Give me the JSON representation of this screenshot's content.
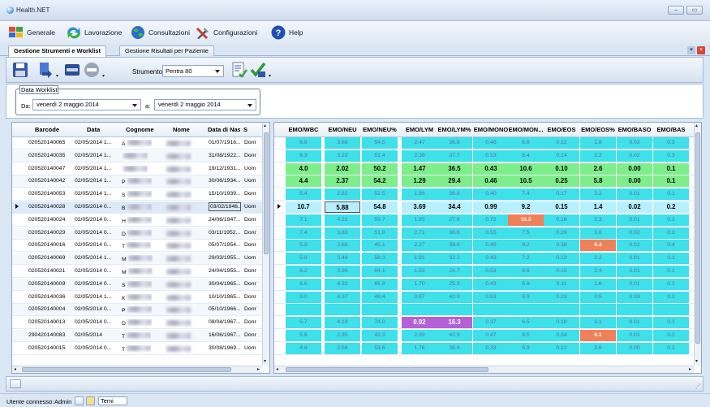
{
  "window": {
    "title": "Health.NET",
    "min_symbol": "–",
    "max_symbol": "▭"
  },
  "menu": [
    {
      "label": "Generale",
      "icon": "generale-icon"
    },
    {
      "label": "Lavorazione",
      "icon": "lavorazione-icon"
    },
    {
      "label": "Consultazioni",
      "icon": "consultazioni-icon"
    },
    {
      "label": "Configurazioni",
      "icon": "configurazioni-icon"
    },
    {
      "label": "Help",
      "icon": "help-icon"
    }
  ],
  "tabs": [
    {
      "label": "Gestione Strumenti e Worklist",
      "active": true
    },
    {
      "label": "Gestione Risultati per Paziente",
      "active": false
    }
  ],
  "toolbar": {
    "strumento_label": "Strumento",
    "strumento_value": "Pentra 80"
  },
  "worklist": {
    "legend": "Data Worklist",
    "da_label": "Da:",
    "da_value": "venerdì 2 maggio 2014",
    "a_label": "a:",
    "a_value": "venerdì 2 maggio 2014"
  },
  "left_grid": {
    "headers": [
      "Barcode",
      "Data",
      "Cognome",
      "Nome",
      "Data di Nas...",
      "S"
    ],
    "rows": [
      {
        "barcode": "020520140065",
        "data": "02/05/2014 1...",
        "cognome": "A",
        "dob": "01/07/1916...",
        "sesso": "Donr"
      },
      {
        "barcode": "020520140035",
        "data": "02/05/2014 1...",
        "cognome": "",
        "dob": "31/08/1922...",
        "sesso": "Donr"
      },
      {
        "barcode": "020520140047",
        "data": "02/05/2014 1...",
        "cognome": "",
        "dob": "19/12/1931...",
        "sesso": "Uom"
      },
      {
        "barcode": "020520140042",
        "data": "02/05/2014 1...",
        "cognome": "P",
        "dob": "30/06/1934...",
        "sesso": "Uom"
      },
      {
        "barcode": "020520140053",
        "data": "02/05/2014 1...",
        "cognome": "S",
        "dob": "15/10/1939...",
        "sesso": "Donr"
      },
      {
        "barcode": "020520140028",
        "data": "02/05/2014 0...",
        "cognome": "B",
        "dob": "03/02/1946...",
        "sesso": "Uom"
      },
      {
        "barcode": "020520140024",
        "data": "02/05/2014 0...",
        "cognome": "H",
        "dob": "24/06/1947...",
        "sesso": "Donr"
      },
      {
        "barcode": "020520140029",
        "data": "02/05/2014 0...",
        "cognome": "D",
        "dob": "03/11/1952...",
        "sesso": "Donr"
      },
      {
        "barcode": "020520140016",
        "data": "02/05/2014 0...",
        "cognome": "T",
        "dob": "05/07/1954...",
        "sesso": "Donr"
      },
      {
        "barcode": "020520140069",
        "data": "02/05/2014 1...",
        "cognome": "M",
        "dob": "29/03/1955...",
        "sesso": "Uom"
      },
      {
        "barcode": "020520140021",
        "data": "02/05/2014 0...",
        "cognome": "M",
        "dob": "24/04/1955...",
        "sesso": "Donr"
      },
      {
        "barcode": "020520140009",
        "data": "02/05/2014 0...",
        "cognome": "S",
        "dob": "30/04/1965...",
        "sesso": "Donr"
      },
      {
        "barcode": "020520140036",
        "data": "02/05/2014 1...",
        "cognome": "K",
        "dob": "10/10/1965...",
        "sesso": "Donr"
      },
      {
        "barcode": "020520140004",
        "data": "02/05/2014 0...",
        "cognome": "P",
        "dob": "05/10/1966...",
        "sesso": "Donr"
      },
      {
        "barcode": "020520140013",
        "data": "02/05/2014 0...",
        "cognome": "D",
        "dob": "08/04/1967...",
        "sesso": "Donr"
      },
      {
        "barcode": "290420140083",
        "data": "02/05/2014",
        "cognome": "T",
        "dob": "16/06/1967...",
        "sesso": "Donr"
      },
      {
        "barcode": "020520140015",
        "data": "02/05/2014 0...",
        "cognome": "T",
        "dob": "30/08/1969...",
        "sesso": "Uom"
      }
    ]
  },
  "right_grid": {
    "headers": [
      "EMO/WBC",
      "EMO/NEU",
      "EMO/NEU%",
      "EMO/LYM",
      "EMO/LYM%",
      "EMO/MONO",
      "EMO/MON...",
      "EMO/EOS",
      "EMO/EOS%",
      "EMO/BASO",
      "EMO/BAS"
    ],
    "rows": [
      {
        "cells": [
          "6.8",
          "3.68",
          "54.5",
          "2.47",
          "36.6",
          "0.46",
          "6.8",
          "0.12",
          "1.8",
          "0.02",
          "0.3"
        ],
        "style": "cyan"
      },
      {
        "cells": [
          "6.3",
          "3.22",
          "51.4",
          "2.36",
          "37.7",
          "0.53",
          "8.4",
          "0.14",
          "2.2",
          "0.02",
          "0.3"
        ],
        "style": "cyan"
      },
      {
        "cells": [
          "4.0",
          "2.02",
          "50.2",
          "1.47",
          "36.5",
          "0.43",
          "10.6",
          "0.10",
          "2.6",
          "0.00",
          "0.1"
        ],
        "style": "green"
      },
      {
        "cells": [
          "4.4",
          "2.37",
          "54.2",
          "1.29",
          "29.4",
          "0.46",
          "10.5",
          "0.25",
          "5.8",
          "0.00",
          "0.1"
        ],
        "style": "green"
      },
      {
        "cells": [
          "5.4",
          "2.82",
          "52.5",
          "1.98",
          "36.8",
          "0.40",
          "7.4",
          "0.17",
          "3.2",
          "0.01",
          "0.1"
        ],
        "style": "cyan"
      },
      {
        "cells": [
          "10.7",
          "5.88",
          "54.8",
          "3.69",
          "34.4",
          "0.99",
          "9.2",
          "0.15",
          "1.4",
          "0.02",
          "0.2"
        ],
        "style": "selected"
      },
      {
        "cells": [
          "7.1",
          "4.21",
          "59.7",
          "1.95",
          "27.6",
          "0.72",
          "10.2",
          "0.16",
          "2.3",
          "0.01",
          "0.2"
        ],
        "style": "cyan",
        "orange": [
          6
        ]
      },
      {
        "cells": [
          "7.4",
          "3.83",
          "51.8",
          "2.71",
          "36.6",
          "0.55",
          "7.5",
          "0.28",
          "3.8",
          "0.02",
          "0.3"
        ],
        "style": "cyan"
      },
      {
        "cells": [
          "5.9",
          "2.68",
          "45.1",
          "2.37",
          "39.9",
          "0.49",
          "8.2",
          "0.38",
          "6.4",
          "0.02",
          "0.4"
        ],
        "style": "cyan",
        "orange": [
          8
        ]
      },
      {
        "cells": [
          "5.9",
          "3.46",
          "58.3",
          "1.91",
          "32.2",
          "0.43",
          "7.2",
          "0.13",
          "2.2",
          "0.01",
          "0.1"
        ],
        "style": "cyan"
      },
      {
        "cells": [
          "6.2",
          "3.96",
          "64.1",
          "1.53",
          "24.7",
          "0.53",
          "8.6",
          "0.15",
          "2.4",
          "0.01",
          "0.1"
        ],
        "style": "cyan"
      },
      {
        "cells": [
          "6.6",
          "4.32",
          "65.8",
          "1.70",
          "25.9",
          "0.43",
          "6.6",
          "0.11",
          "1.6",
          "0.01",
          "0.1"
        ],
        "style": "cyan"
      },
      {
        "cells": [
          "9.0",
          "4.37",
          "48.4",
          "3.87",
          "42.9",
          "0.53",
          "5.9",
          "0.23",
          "2.5",
          "0.03",
          "0.3"
        ],
        "style": "cyan"
      },
      {
        "cells": [
          "",
          "",
          "",
          "",
          "",
          "",
          "",
          "",
          "",
          "",
          ""
        ],
        "style": "cyan"
      },
      {
        "cells": [
          "5.7",
          "4.19",
          "74.0",
          "0.92",
          "16.3",
          "0.37",
          "6.5",
          "0.18",
          "3.1",
          "0.01",
          "0.1"
        ],
        "style": "cyan",
        "purple": [
          3,
          4
        ]
      },
      {
        "cells": [
          "5.6",
          "2.35",
          "42.3",
          "2.39",
          "42.9",
          "0.47",
          "8.5",
          "0.34",
          "6.1",
          "0.01",
          "0.2"
        ],
        "style": "cyan",
        "orange": [
          8
        ]
      },
      {
        "cells": [
          "4.8",
          "2.56",
          "53.6",
          "1.76",
          "36.8",
          "0.33",
          "6.9",
          "0.12",
          "2.6",
          "0.00",
          "0.1"
        ],
        "style": "cyan"
      }
    ]
  },
  "status": {
    "user_label": "Utente connesso:",
    "user_value": "Admin",
    "temi_label": "Temi"
  },
  "colors": {
    "cyan": "#3ee0ea",
    "green": "#7dee8a",
    "orange": "#f08058",
    "purple": "#b560d8",
    "selected_bg": "#b7efff"
  }
}
